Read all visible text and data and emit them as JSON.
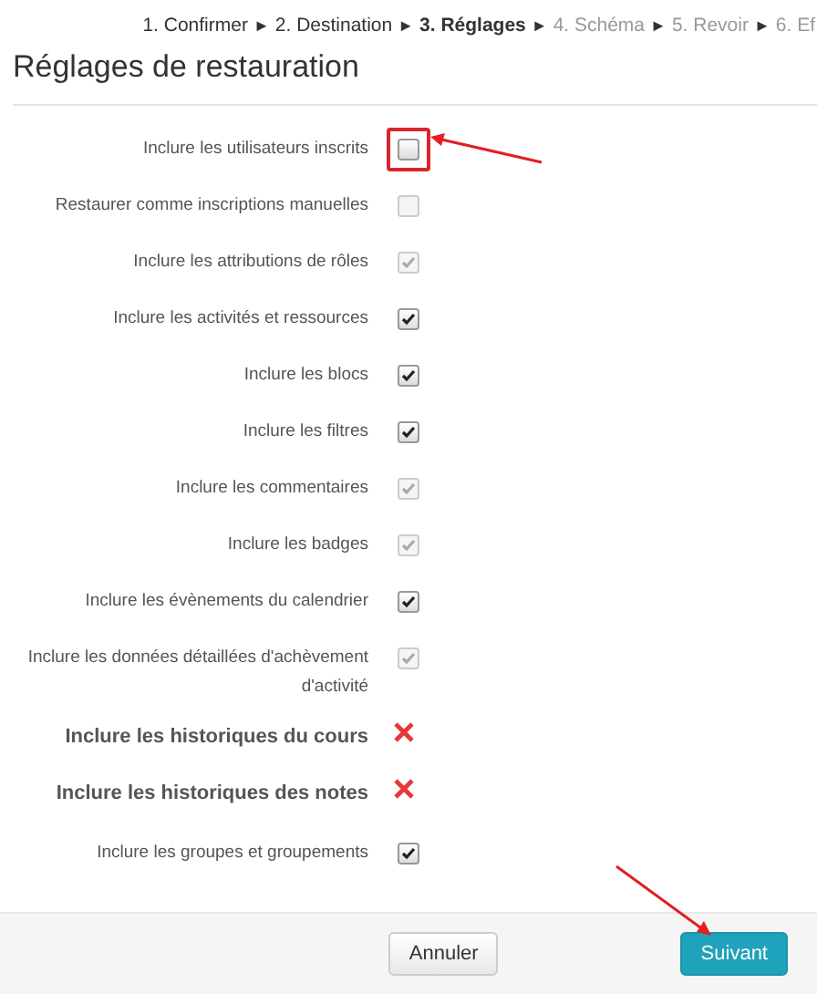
{
  "breadcrumb": [
    {
      "label": "1. Confirmer",
      "selected": false,
      "disabled": false
    },
    {
      "label": "2. Destination",
      "selected": false,
      "disabled": false
    },
    {
      "label": "3. Réglages",
      "selected": true,
      "disabled": false
    },
    {
      "label": "4. Schéma",
      "selected": false,
      "disabled": true
    },
    {
      "label": "5. Revoir",
      "selected": false,
      "disabled": true
    },
    {
      "label": "6. Ef",
      "selected": false,
      "disabled": true
    }
  ],
  "separator": "►",
  "title": "Réglages de restauration",
  "settings": [
    {
      "label": "Inclure les utilisateurs inscrits",
      "kind": "checkbox",
      "checked": false,
      "disabled": false,
      "highlighted": true
    },
    {
      "label": "Restaurer comme inscriptions manuelles",
      "kind": "checkbox",
      "checked": false,
      "disabled": true,
      "highlighted": false
    },
    {
      "label": "Inclure les attributions de rôles",
      "kind": "checkbox",
      "checked": true,
      "disabled": true,
      "highlighted": false
    },
    {
      "label": "Inclure les activités et ressources",
      "kind": "checkbox",
      "checked": true,
      "disabled": false,
      "highlighted": false
    },
    {
      "label": "Inclure les blocs",
      "kind": "checkbox",
      "checked": true,
      "disabled": false,
      "highlighted": false
    },
    {
      "label": "Inclure les filtres",
      "kind": "checkbox",
      "checked": true,
      "disabled": false,
      "highlighted": false
    },
    {
      "label": "Inclure les commentaires",
      "kind": "checkbox",
      "checked": true,
      "disabled": true,
      "highlighted": false
    },
    {
      "label": "Inclure les badges",
      "kind": "checkbox",
      "checked": true,
      "disabled": true,
      "highlighted": false
    },
    {
      "label": "Inclure les évènements du calendrier",
      "kind": "checkbox",
      "checked": true,
      "disabled": false,
      "highlighted": false
    },
    {
      "label": "Inclure les données détaillées d'achèvement d'activité",
      "kind": "checkbox",
      "checked": true,
      "disabled": true,
      "highlighted": false
    },
    {
      "label": "Inclure les historiques du cours",
      "kind": "locked"
    },
    {
      "label": "Inclure les historiques des notes",
      "kind": "locked"
    },
    {
      "label": "Inclure les groupes et groupements",
      "kind": "checkbox",
      "checked": true,
      "disabled": false,
      "highlighted": false
    }
  ],
  "buttons": [
    {
      "label": "Annuler",
      "kind": "secondary"
    },
    {
      "label": "Suivant",
      "kind": "primary"
    }
  ]
}
